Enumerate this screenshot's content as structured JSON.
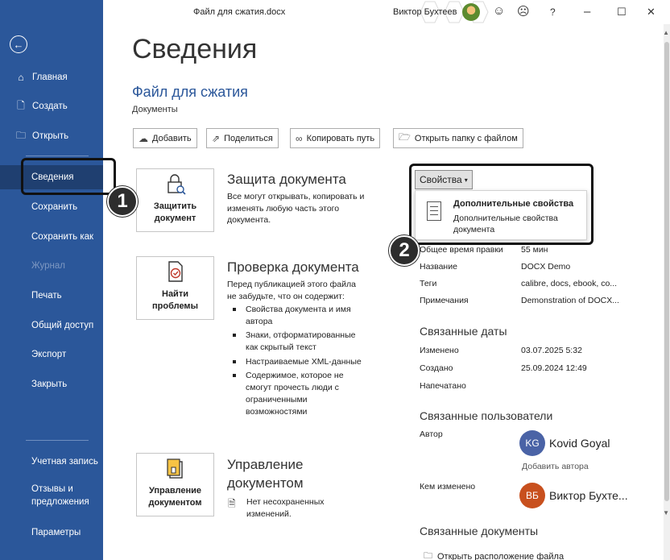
{
  "window": {
    "doc_title": "Файл для сжатия.docx",
    "user_name": "Виктор Бухтеев",
    "icons": [
      "smiley-icon",
      "frown-icon",
      "help-icon",
      "minimize-icon",
      "maximize-icon",
      "close-icon"
    ],
    "help_label": "?",
    "minimize_label": "–",
    "maximize_label": "☐",
    "close_label": "✕"
  },
  "sidebar": {
    "back_label": "←",
    "items": [
      {
        "label": "Главная",
        "icon": "home-icon"
      },
      {
        "label": "Создать",
        "icon": "new-document-icon"
      },
      {
        "label": "Открыть",
        "icon": "folder-icon"
      },
      {
        "label": "Сведения",
        "active": true
      },
      {
        "label": "Сохранить"
      },
      {
        "label": "Сохранить как"
      },
      {
        "label": "Журнал",
        "disabled": true
      },
      {
        "label": "Печать"
      },
      {
        "label": "Общий доступ"
      },
      {
        "label": "Экспорт"
      },
      {
        "label": "Закрыть"
      }
    ],
    "bottom_items": [
      {
        "label": "Учетная запись"
      },
      {
        "label": "Отзывы и предложения"
      },
      {
        "label": "Параметры"
      }
    ],
    "colors": {
      "background": "#2b579a",
      "active": "#1f3f70"
    }
  },
  "main": {
    "title": "Сведения",
    "file_name": "Файл для сжатия",
    "file_location": "Документы",
    "actions": [
      {
        "label": "Добавить",
        "icon": "upload-icon"
      },
      {
        "label": "Поделиться",
        "icon": "share-icon"
      },
      {
        "label": "Копировать путь",
        "icon": "link-icon"
      },
      {
        "label": "Открыть папку с файлом",
        "icon": "folder-open-icon"
      }
    ],
    "protect": {
      "button": "Защитить документ",
      "title": "Защита документа",
      "text": "Все могут открывать, копировать и изменять любую часть этого документа."
    },
    "inspect": {
      "button": "Найти проблемы",
      "title": "Проверка документа",
      "text": "Перед публикацией этого файла не забудьте, что он содержит:",
      "bullets": [
        "Свойства документа и имя автора",
        "Знаки, отформатированные как скрытый текст",
        "Настраиваемые XML-данные",
        "Содержимое, которое не смогут прочесть люди с ограниченными возможностями"
      ]
    },
    "manage": {
      "button": "Управление документом",
      "title": "Управление документом",
      "text": "Нет несохраненных изменений."
    }
  },
  "properties": {
    "dropdown_label": "Свойства",
    "popup": {
      "title": "Дополнительные свойства",
      "description": "Дополнительные свойства документа"
    },
    "fields": [
      {
        "label": "Общее время правки",
        "value": "55 мин"
      },
      {
        "label": "Название",
        "value": "DOCX Demo"
      },
      {
        "label": "Теги",
        "value": "calibre, docs, ebook, co..."
      },
      {
        "label": "Примечания",
        "value": "Demonstration of DOCX..."
      }
    ],
    "dates_title": "Связанные даты",
    "dates": [
      {
        "label": "Изменено",
        "value": "03.07.2025 5:32"
      },
      {
        "label": "Создано",
        "value": "25.09.2024 12:49"
      },
      {
        "label": "Напечатано",
        "value": ""
      }
    ],
    "people_title": "Связанные пользователи",
    "author_label": "Автор",
    "author": {
      "initials": "KG",
      "name": "Kovid Goyal",
      "color": "#4a63a6"
    },
    "add_author": "Добавить автора",
    "modified_by_label": "Кем изменено",
    "modified_by": {
      "initials": "ВБ",
      "name": "Виктор Бухте...",
      "color": "#c8501e"
    },
    "docs_title": "Связанные документы",
    "open_location": "Открыть расположение файла"
  },
  "annotations": {
    "badge1": "1",
    "badge2": "2"
  }
}
